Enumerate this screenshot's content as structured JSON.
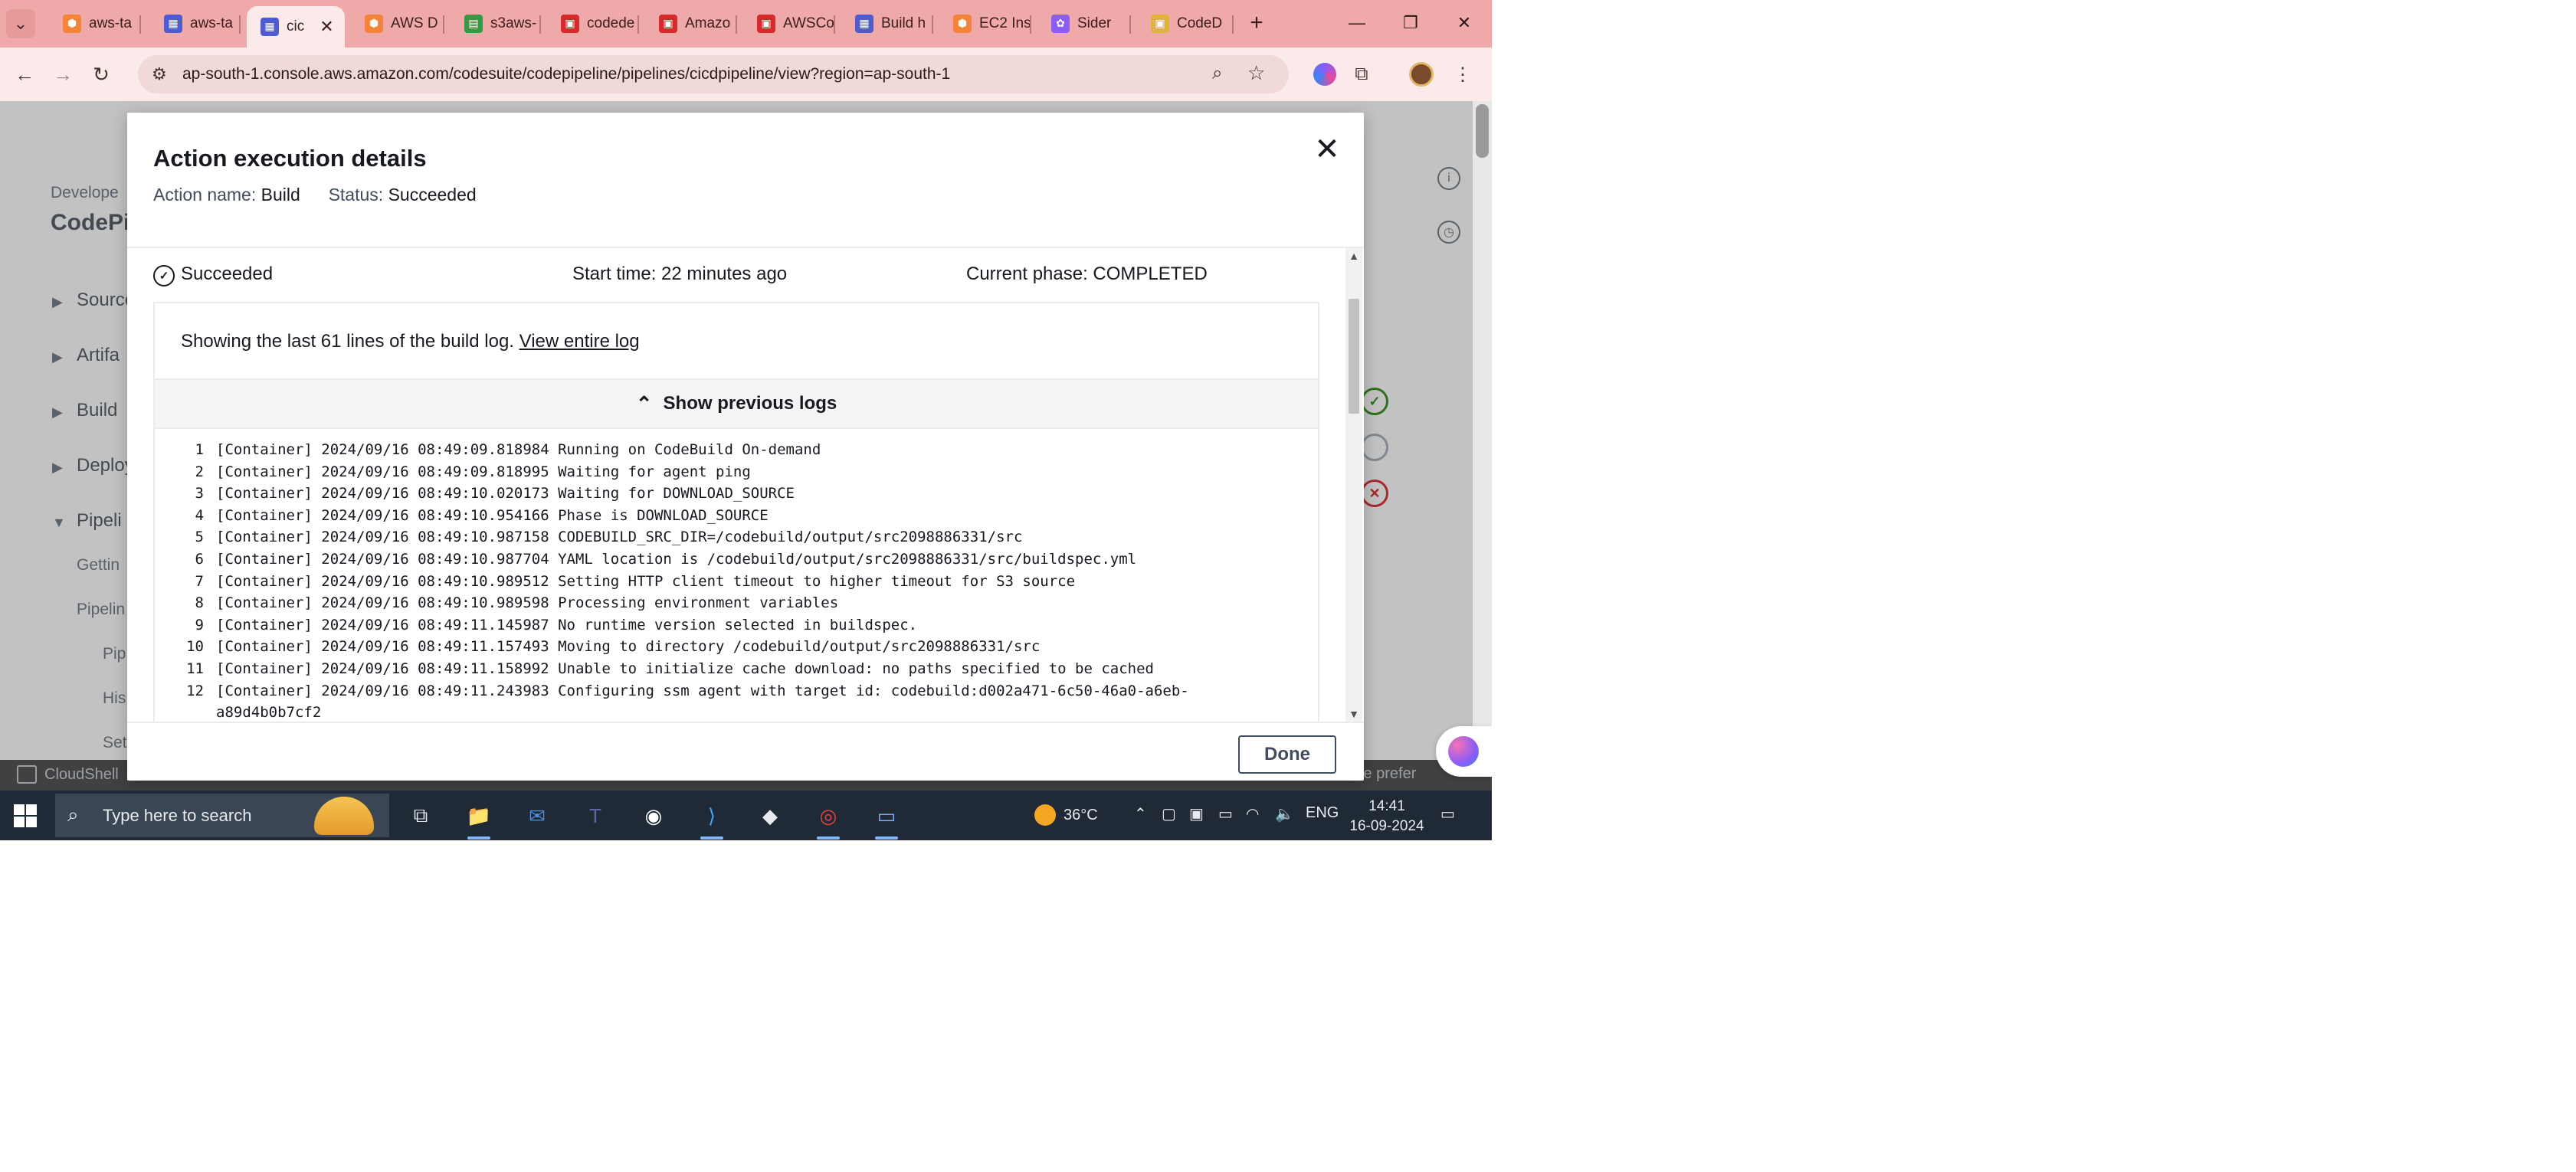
{
  "browser": {
    "tabs": [
      {
        "title": "aws-ta",
        "favicon": "aws-icon",
        "color": "#f58536",
        "glyph": "⬢"
      },
      {
        "title": "aws-ta",
        "favicon": "document-icon",
        "color": "#4f5bd5",
        "glyph": "▦"
      },
      {
        "title": "cic",
        "favicon": "document-icon",
        "color": "#4f5bd5",
        "glyph": "▦",
        "active": true
      },
      {
        "title": "AWS D",
        "favicon": "aws-icon",
        "color": "#f58536",
        "glyph": "⬢"
      },
      {
        "title": "s3aws-",
        "favicon": "sheet-icon",
        "color": "#2e9e44",
        "glyph": "▤"
      },
      {
        "title": "codede",
        "favicon": "aws-service-icon",
        "color": "#d52b2b",
        "glyph": "▣"
      },
      {
        "title": "Amazo",
        "favicon": "aws-service-icon",
        "color": "#d52b2b",
        "glyph": "▣"
      },
      {
        "title": "AWSCo",
        "favicon": "aws-service-icon",
        "color": "#d52b2b",
        "glyph": "▣"
      },
      {
        "title": "Build h",
        "favicon": "document-icon",
        "color": "#4f5bd5",
        "glyph": "▦"
      },
      {
        "title": "EC2 Ins",
        "favicon": "aws-icon",
        "color": "#f58536",
        "glyph": "⬢"
      },
      {
        "title": "Sider",
        "favicon": "sider-icon",
        "color": "#8b5cf6",
        "glyph": "✿"
      },
      {
        "title": "CodeD",
        "favicon": "aws-service-icon",
        "color": "#e0b43a",
        "glyph": "▣"
      }
    ],
    "url": "ap-south-1.console.aws.amazon.com/codesuite/codepipeline/pipelines/cicdpipeline/view?region=ap-south-1"
  },
  "background_page": {
    "sidebar": {
      "header": "Develope",
      "title": "CodePi",
      "sections": [
        "Source",
        "Artifa",
        "Build",
        "Deploy",
        "Pipeli"
      ],
      "subitems": [
        "Gettin",
        "Pipelin",
        "Pip",
        "His",
        "Set"
      ]
    },
    "cloudshell_label": "CloudShell",
    "preferences_label": "ie prefer"
  },
  "modal": {
    "title": "Action execution details",
    "action_name_label": "Action name:",
    "action_name_value": "Build",
    "status_label": "Status:",
    "status_value": "Succeeded",
    "summary": {
      "status": "Succeeded",
      "start_time": "Start time: 22 minutes ago",
      "current_phase": "Current phase: COMPLETED"
    },
    "log_summary_text": "Showing the last 61 lines of the build log.",
    "view_entire_log": "View entire log",
    "show_previous_logs": "Show previous logs",
    "log_lines": [
      {
        "n": "1",
        "text": "[Container] 2024/09/16 08:49:09.818984 Running on CodeBuild On-demand"
      },
      {
        "n": "2",
        "text": "[Container] 2024/09/16 08:49:09.818995 Waiting for agent ping"
      },
      {
        "n": "3",
        "text": "[Container] 2024/09/16 08:49:10.020173 Waiting for DOWNLOAD_SOURCE"
      },
      {
        "n": "4",
        "text": "[Container] 2024/09/16 08:49:10.954166 Phase is DOWNLOAD_SOURCE"
      },
      {
        "n": "5",
        "text": "[Container] 2024/09/16 08:49:10.987158 CODEBUILD_SRC_DIR=/codebuild/output/src2098886331/src"
      },
      {
        "n": "6",
        "text": "[Container] 2024/09/16 08:49:10.987704 YAML location is /codebuild/output/src2098886331/src/buildspec.yml"
      },
      {
        "n": "7",
        "text": "[Container] 2024/09/16 08:49:10.989512 Setting HTTP client timeout to higher timeout for S3 source"
      },
      {
        "n": "8",
        "text": "[Container] 2024/09/16 08:49:10.989598 Processing environment variables"
      },
      {
        "n": "9",
        "text": "[Container] 2024/09/16 08:49:11.145987 No runtime version selected in buildspec."
      },
      {
        "n": "10",
        "text": "[Container] 2024/09/16 08:49:11.157493 Moving to directory /codebuild/output/src2098886331/src"
      },
      {
        "n": "11",
        "text": "[Container] 2024/09/16 08:49:11.158992 Unable to initialize cache download: no paths specified to be cached"
      },
      {
        "n": "12",
        "text": "[Container] 2024/09/16 08:49:11.243983 Configuring ssm agent with target id: codebuild:d002a471-6c50-46a0-a6eb-"
      },
      {
        "n": "",
        "text": "a89d4b0b7cf2"
      }
    ],
    "done_label": "Done"
  },
  "taskbar": {
    "search_placeholder": "Type here to search",
    "weather": "36°C",
    "language": "ENG",
    "time": "14:41",
    "date": "16-09-2024",
    "apps": [
      {
        "name": "task-view-icon",
        "glyph": "⧉"
      },
      {
        "name": "file-explorer-icon",
        "glyph": "📁"
      },
      {
        "name": "mail-icon",
        "glyph": "✉"
      },
      {
        "name": "teams-icon",
        "glyph": "T"
      },
      {
        "name": "github-icon",
        "glyph": "◉"
      },
      {
        "name": "vscode-icon",
        "glyph": "⟩"
      },
      {
        "name": "git-icon",
        "glyph": "◆"
      },
      {
        "name": "chrome-icon",
        "glyph": "◎"
      },
      {
        "name": "notepad-icon",
        "glyph": "▭"
      }
    ]
  }
}
